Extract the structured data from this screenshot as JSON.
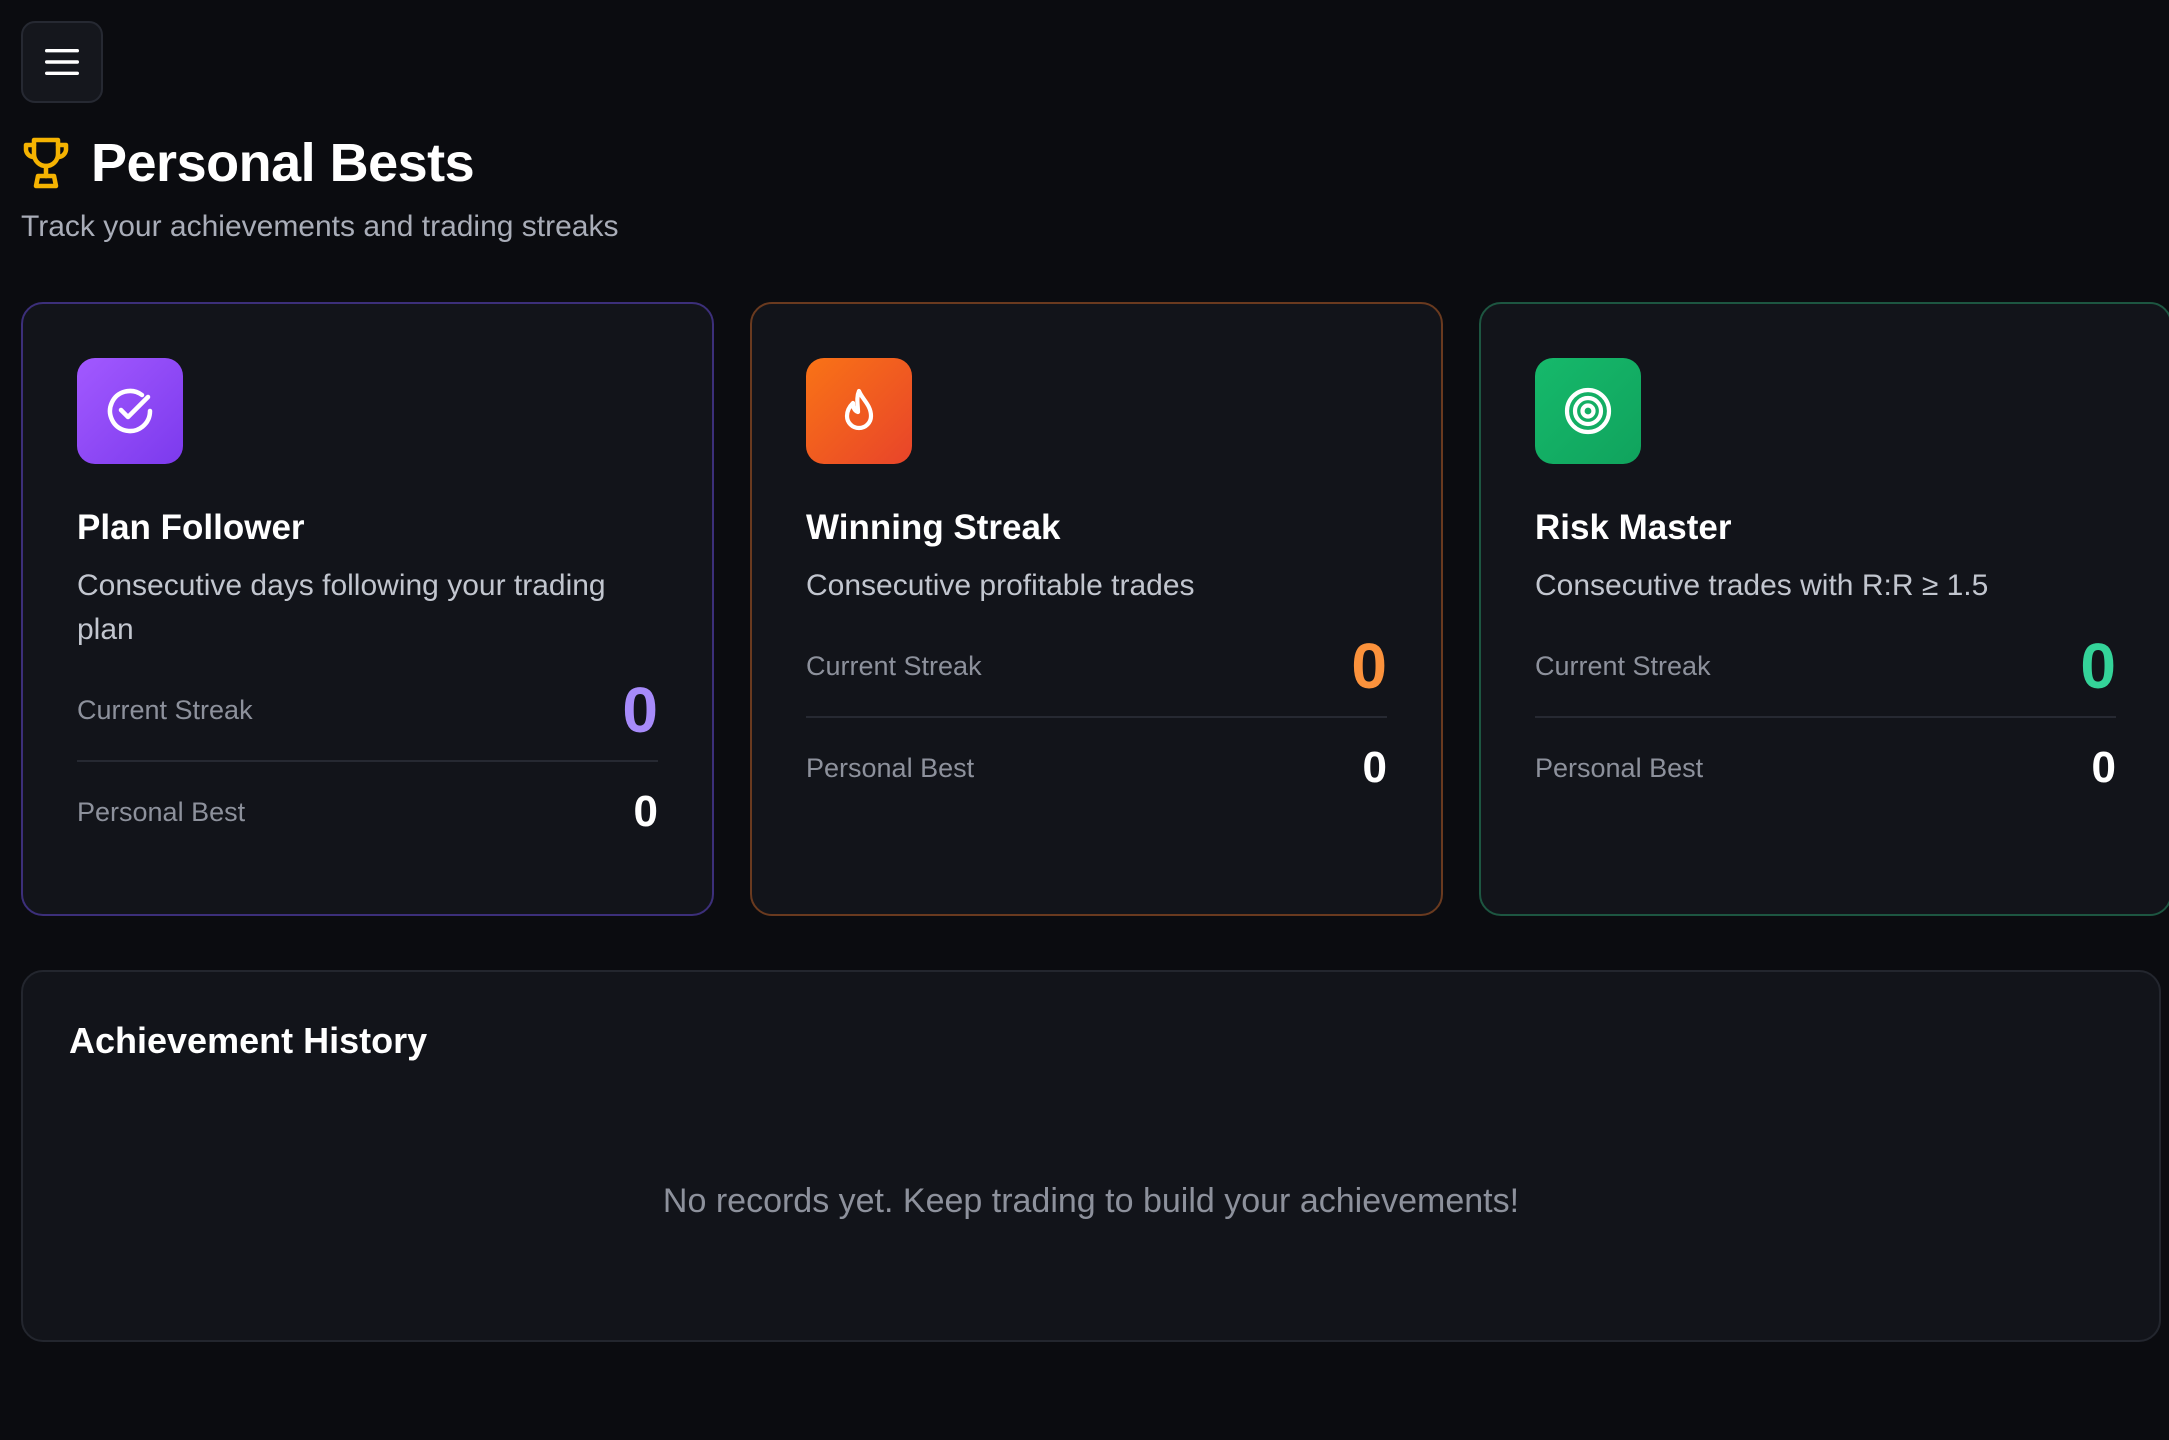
{
  "header": {
    "title": "Personal Bests",
    "subtitle": "Track your achievements and trading streaks"
  },
  "colors": {
    "background": "#0b0c10",
    "card": "#12141a",
    "purple": "#a78bfa",
    "orange": "#fb923c",
    "green": "#34d399",
    "trophy": "#f5b301"
  },
  "cards": [
    {
      "title": "Plan Follower",
      "description": "Consecutive days following your trading plan",
      "icon": "check-circle-icon",
      "current_label": "Current Streak",
      "current_value": "0",
      "best_label": "Personal Best",
      "best_value": "0"
    },
    {
      "title": "Winning Streak",
      "description": "Consecutive profitable trades",
      "icon": "flame-icon",
      "current_label": "Current Streak",
      "current_value": "0",
      "best_label": "Personal Best",
      "best_value": "0"
    },
    {
      "title": "Risk Master",
      "description": "Consecutive trades with R:R ≥ 1.5",
      "icon": "target-icon",
      "current_label": "Current Streak",
      "current_value": "0",
      "best_label": "Personal Best",
      "best_value": "0"
    }
  ],
  "history": {
    "title": "Achievement History",
    "empty_message": "No records yet. Keep trading to build your achievements!"
  }
}
